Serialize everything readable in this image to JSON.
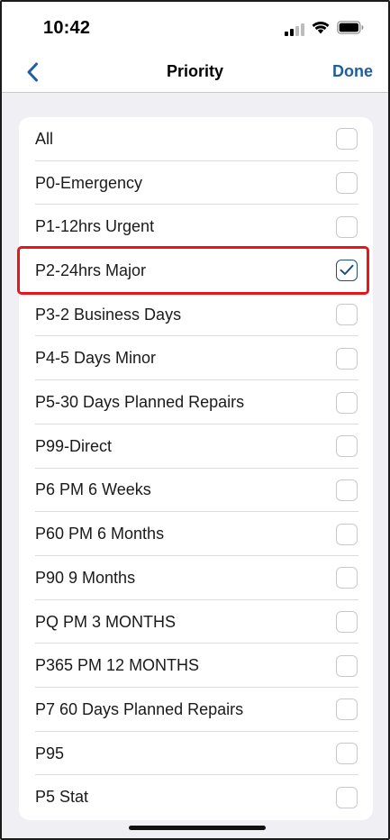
{
  "status_bar": {
    "time": "10:42",
    "icons": [
      "cellular-signal-icon",
      "wifi-icon",
      "battery-icon"
    ]
  },
  "nav": {
    "back_icon": "chevron-left-icon",
    "title": "Priority",
    "done_label": "Done"
  },
  "colors": {
    "accent": "#1f5fa0",
    "highlight": "#e8161b",
    "background": "#efeff4"
  },
  "priorities": [
    {
      "label": "All",
      "checked": false
    },
    {
      "label": "P0-Emergency",
      "checked": false
    },
    {
      "label": "P1-12hrs Urgent",
      "checked": false
    },
    {
      "label": "P2-24hrs Major",
      "checked": true
    },
    {
      "label": "P3-2 Business Days",
      "checked": false
    },
    {
      "label": "P4-5 Days Minor",
      "checked": false
    },
    {
      "label": "P5-30 Days Planned Repairs",
      "checked": false
    },
    {
      "label": "P99-Direct",
      "checked": false
    },
    {
      "label": "P6 PM 6 Weeks",
      "checked": false
    },
    {
      "label": "P60 PM 6 Months",
      "checked": false
    },
    {
      "label": "P90 9 Months",
      "checked": false
    },
    {
      "label": "PQ PM 3 MONTHS",
      "checked": false
    },
    {
      "label": "P365 PM 12 MONTHS",
      "checked": false
    },
    {
      "label": "P7 60 Days Planned Repairs",
      "checked": false
    },
    {
      "label": "P95",
      "checked": false
    },
    {
      "label": "P5 Stat",
      "checked": false
    }
  ]
}
